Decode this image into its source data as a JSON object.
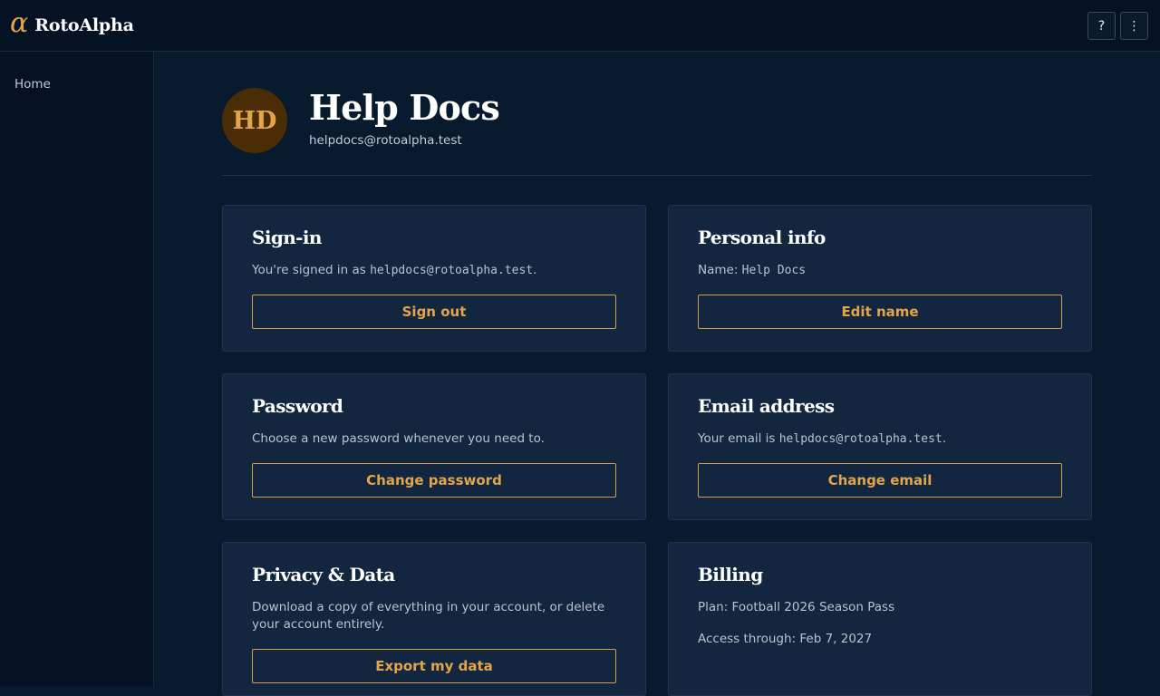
{
  "app": {
    "logo_glyph": "α",
    "name": "RotoAlpha"
  },
  "topbar": {
    "help_label": "?",
    "menu_label": "⋮"
  },
  "sidebar": {
    "items": [
      {
        "label": "Home"
      }
    ]
  },
  "profile": {
    "initials": "HD",
    "name": "Help Docs",
    "email": "helpdocs@rotoalpha.test"
  },
  "cards": {
    "signin": {
      "title": "Sign-in",
      "text_prefix": "You're signed in as ",
      "text_email": "helpdocs@rotoalpha.test",
      "text_suffix": ".",
      "button": "Sign out"
    },
    "personal": {
      "title": "Personal info",
      "text_prefix": "Name: ",
      "text_value": "Help Docs",
      "button": "Edit name"
    },
    "password": {
      "title": "Password",
      "text": "Choose a new password whenever you need to.",
      "button": "Change password"
    },
    "email": {
      "title": "Email address",
      "text_prefix": "Your email is ",
      "text_email": "helpdocs@rotoalpha.test",
      "text_suffix": ".",
      "button": "Change email"
    },
    "privacy": {
      "title": "Privacy & Data",
      "text": "Download a copy of everything in your account, or delete your account entirely.",
      "button": "Export my data"
    },
    "billing": {
      "title": "Billing",
      "plan": "Plan: Football 2026 Season Pass",
      "access": "Access through: Feb 7, 2027"
    }
  },
  "colors": {
    "accent": "#e3a54a",
    "background": "#081a2d",
    "card": "#12263f",
    "topbar": "#041224"
  }
}
